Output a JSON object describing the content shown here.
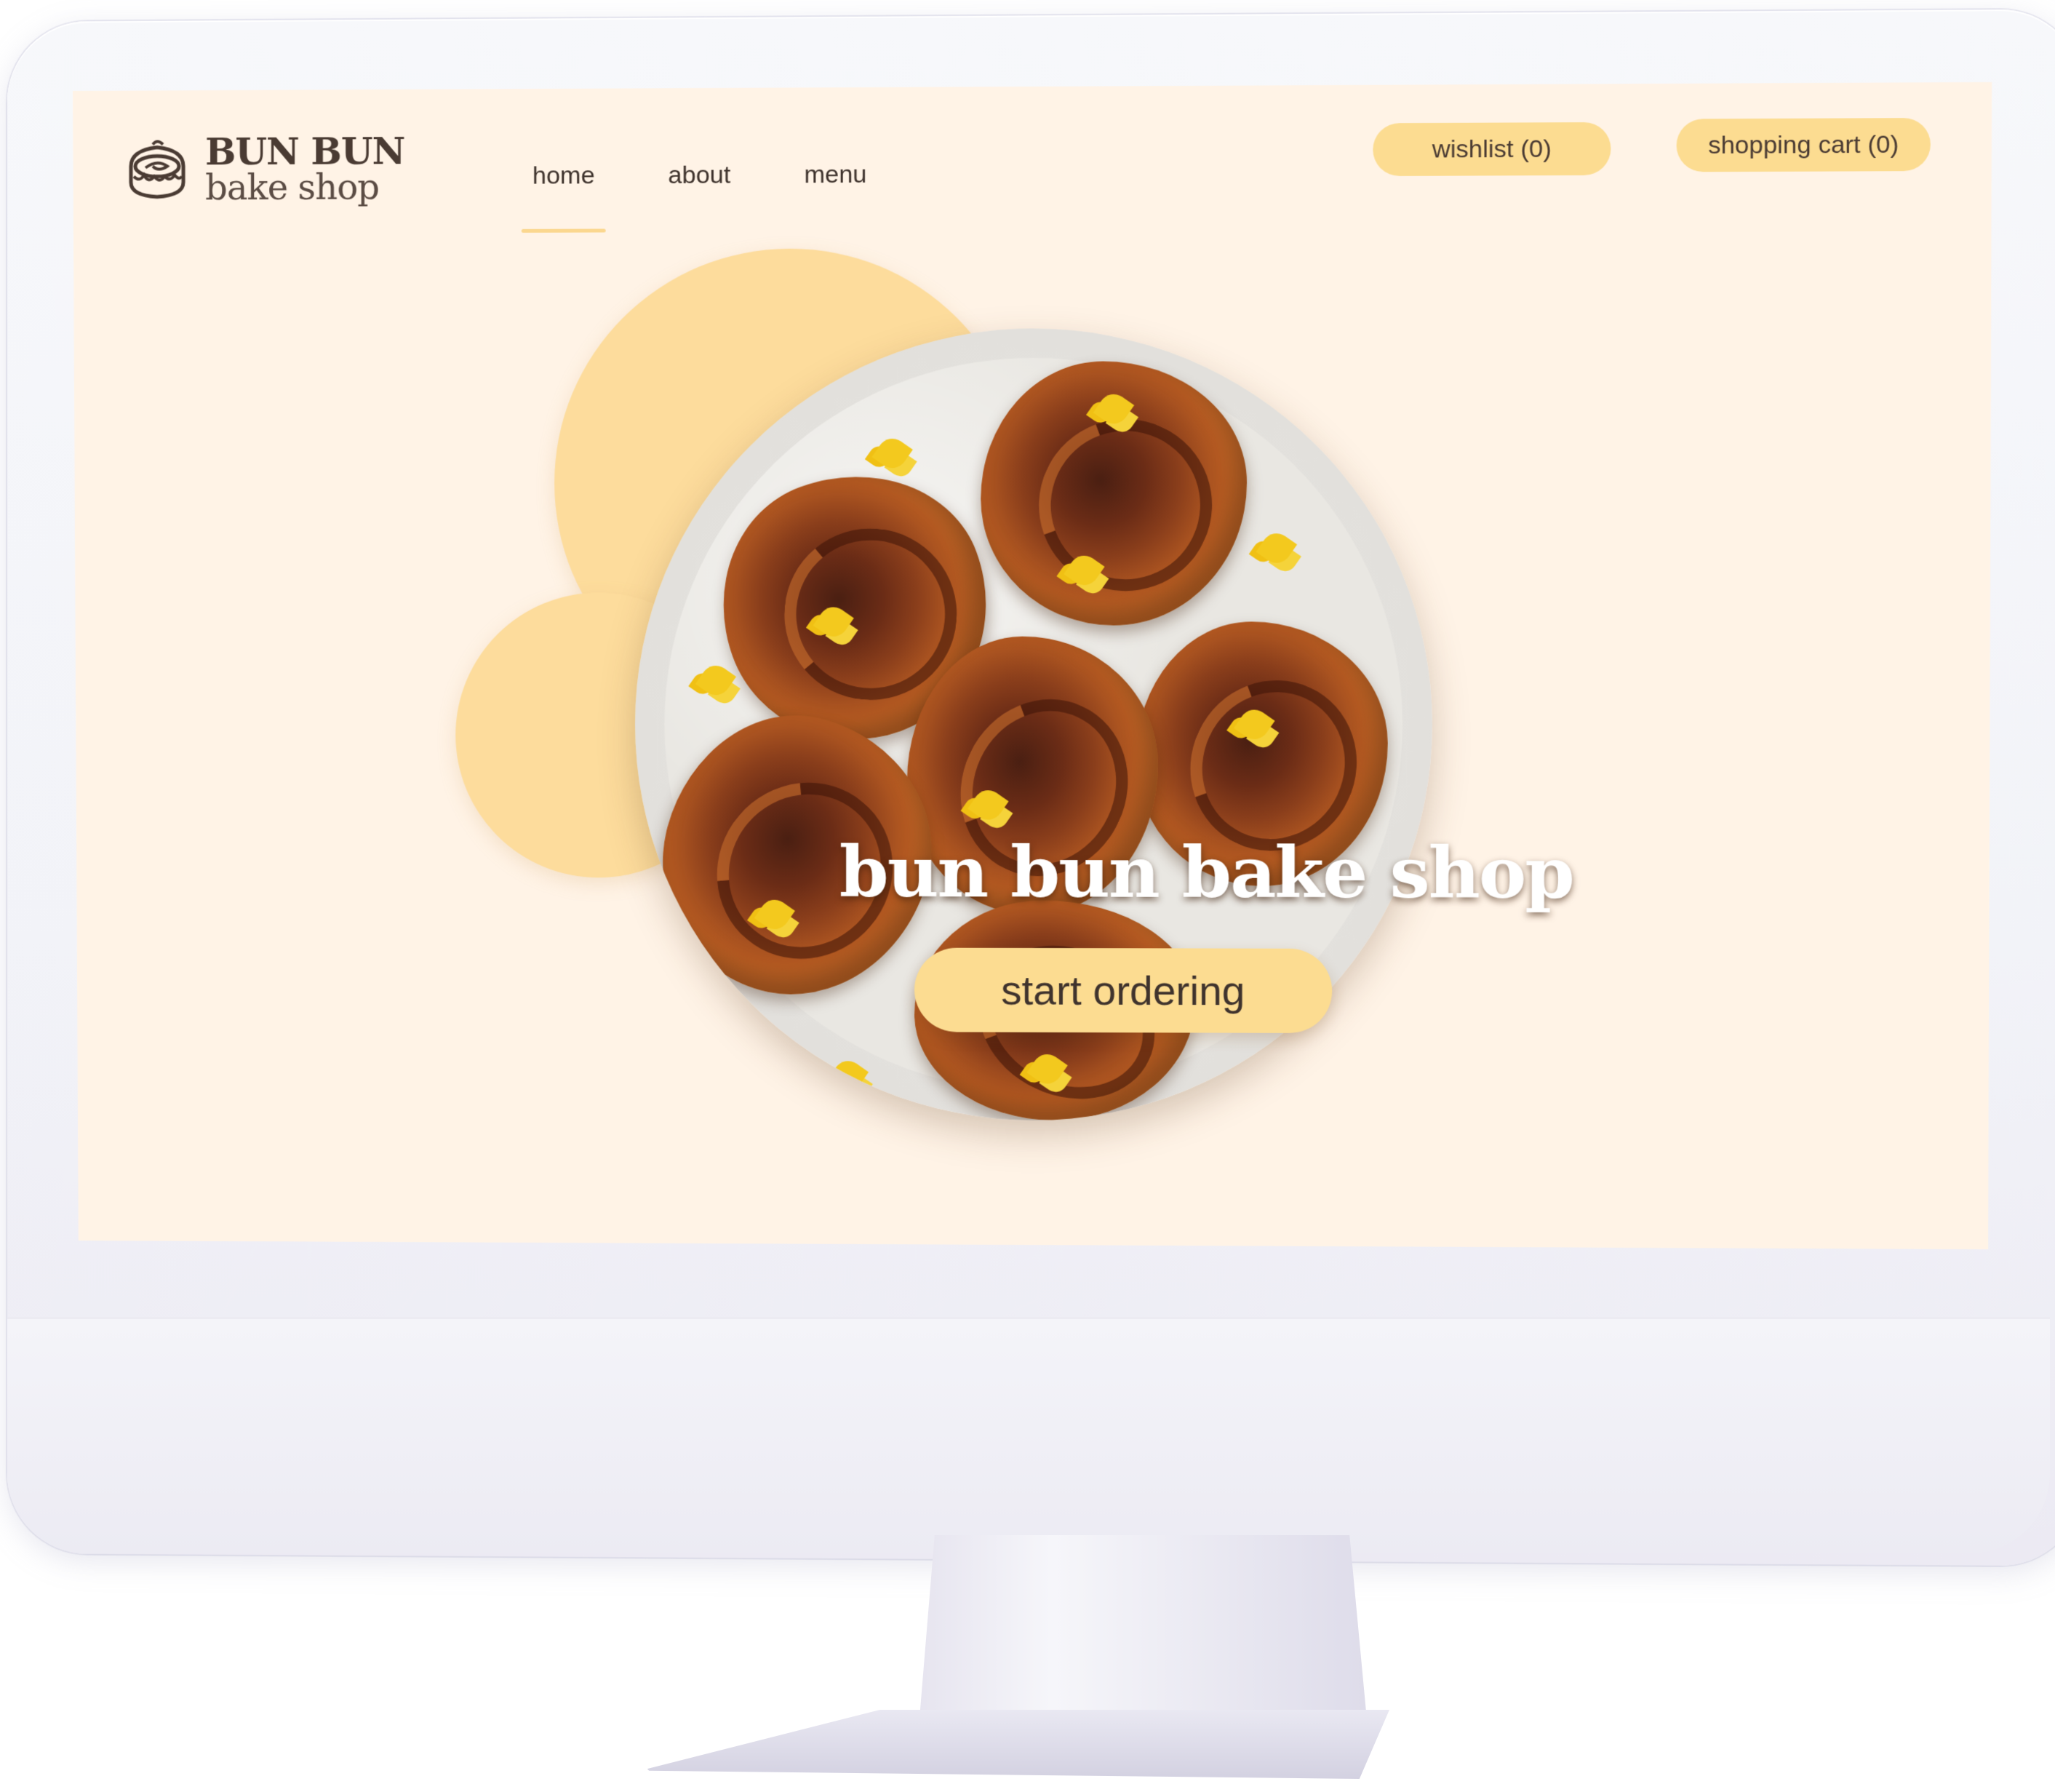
{
  "brand": {
    "line1": "BUN BUN",
    "line2": "bake shop",
    "logo_icon": "cinnamon-bun-icon"
  },
  "nav": {
    "items": [
      {
        "label": "home",
        "active": true
      },
      {
        "label": "about",
        "active": false
      },
      {
        "label": "menu",
        "active": false
      }
    ]
  },
  "header_actions": {
    "wishlist_label": "wishlist (0)",
    "cart_label": "shopping cart (0)"
  },
  "hero": {
    "title": "bun bun bake shop",
    "cta_label": "start ordering",
    "image_subject": "plate of cinnamon buns with yellow flowers"
  },
  "colors": {
    "background": "#fff3e6",
    "accent": "#fcdc91",
    "text": "#3f332d",
    "hero_title": "#ffffff"
  }
}
